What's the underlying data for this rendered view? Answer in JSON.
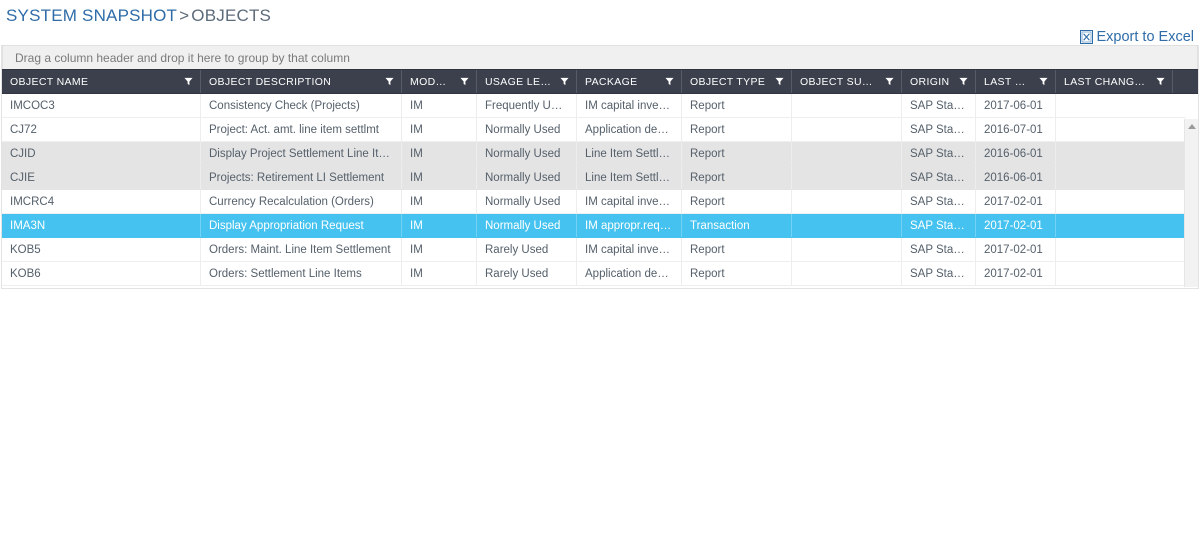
{
  "breadcrumb": {
    "primary": "SYSTEM SNAPSHOT",
    "separator": ">",
    "current": "OBJECTS"
  },
  "toolbar": {
    "export_label": "Export to Excel",
    "export_icon": "excel-icon"
  },
  "grid": {
    "group_hint": "Drag a column header and drop it here to group by that column",
    "filter_icon": "filter-funnel-icon",
    "scroll_up_icon": "scroll-up-arrow-icon",
    "columns": [
      "OBJECT NAME",
      "OBJECT DESCRIPTION",
      "MODULE",
      "USAGE LEVEL",
      "PACKAGE",
      "OBJECT TYPE",
      "OBJECT SUB TYPE",
      "ORIGIN",
      "LAST USED",
      "LAST CHANGED BY"
    ],
    "rows": [
      {
        "object_name": "IMCOC3",
        "object_description": "Consistency Check (Projects)",
        "module": "IM",
        "usage_level": "Frequently Used",
        "package": "IM capital investme...",
        "object_type": "Report",
        "object_sub_type": "",
        "origin": "SAP Standard",
        "last_used": "2017-06-01",
        "last_changed_by": "",
        "state": "normal"
      },
      {
        "object_name": "CJ72",
        "object_description": "Project: Act. amt. line item settlmt",
        "module": "IM",
        "usage_level": "Normally Used",
        "package": "Application develo...",
        "object_type": "Report",
        "object_sub_type": "",
        "origin": "SAP Standard",
        "last_used": "2016-07-01",
        "last_changed_by": "",
        "state": "normal"
      },
      {
        "object_name": "CJID",
        "object_description": "Display Project Settlement Line Itms",
        "module": "IM",
        "usage_level": "Normally Used",
        "package": "Line Item Settleme...",
        "object_type": "Report",
        "object_sub_type": "",
        "origin": "SAP Standard",
        "last_used": "2016-06-01",
        "last_changed_by": "",
        "state": "alt"
      },
      {
        "object_name": "CJIE",
        "object_description": "Projects: Retirement LI Settlement",
        "module": "IM",
        "usage_level": "Normally Used",
        "package": "Line Item Settleme...",
        "object_type": "Report",
        "object_sub_type": "",
        "origin": "SAP Standard",
        "last_used": "2016-06-01",
        "last_changed_by": "",
        "state": "alt"
      },
      {
        "object_name": "IMCRC4",
        "object_description": "Currency Recalculation (Orders)",
        "module": "IM",
        "usage_level": "Normally Used",
        "package": "IM capital investme...",
        "object_type": "Report",
        "object_sub_type": "",
        "origin": "SAP Standard",
        "last_used": "2017-02-01",
        "last_changed_by": "",
        "state": "normal"
      },
      {
        "object_name": "IMA3N",
        "object_description": "Display Appropriation Request",
        "module": "IM",
        "usage_level": "Normally Used",
        "package": "IM appropr.reqs.(m...",
        "object_type": "Transaction",
        "object_sub_type": "",
        "origin": "SAP Standard",
        "last_used": "2017-02-01",
        "last_changed_by": "",
        "state": "selected"
      },
      {
        "object_name": "KOB5",
        "object_description": "Orders: Maint. Line Item Settlement",
        "module": "IM",
        "usage_level": "Rarely Used",
        "package": "IM capital investme...",
        "object_type": "Report",
        "object_sub_type": "",
        "origin": "SAP Standard",
        "last_used": "2017-02-01",
        "last_changed_by": "",
        "state": "normal"
      },
      {
        "object_name": "KOB6",
        "object_description": "Orders: Settlement Line Items",
        "module": "IM",
        "usage_level": "Rarely Used",
        "package": "Application develo...",
        "object_type": "Report",
        "object_sub_type": "",
        "origin": "SAP Standard",
        "last_used": "2017-02-01",
        "last_changed_by": "",
        "state": "normal"
      }
    ]
  },
  "colors": {
    "header_bg": "#3b404c",
    "selection": "#45c2ef",
    "link": "#2f6ca8",
    "alt_row": "#e4e4e4",
    "group_bar": "#f0f0f0"
  }
}
